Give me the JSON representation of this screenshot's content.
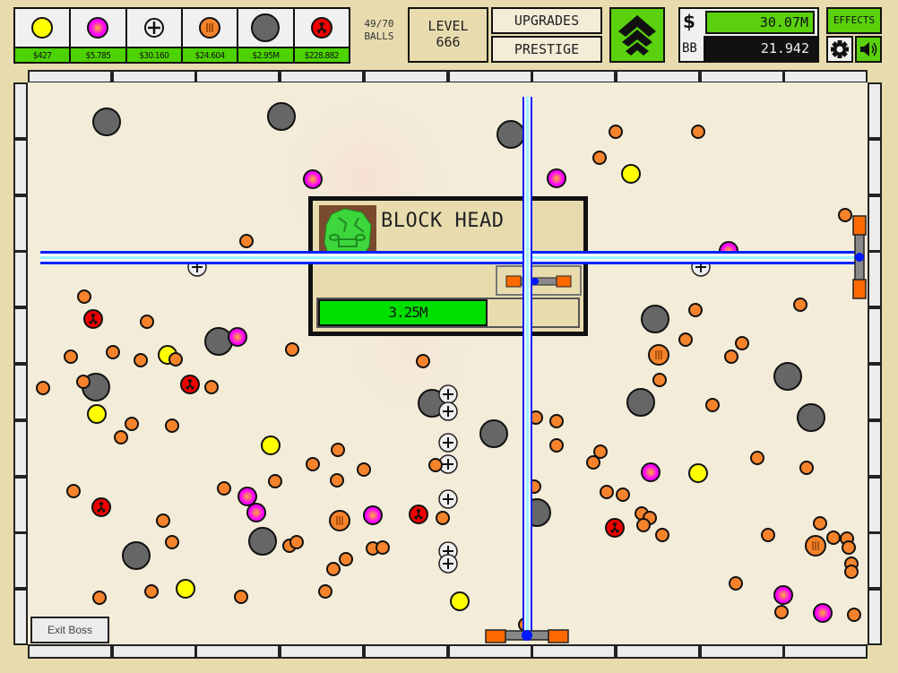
{
  "shop": [
    {
      "ball": "yellow-ball",
      "price": "$427"
    },
    {
      "ball": "plasma-ball",
      "price": "$5.785"
    },
    {
      "ball": "scatter-ball",
      "price": "$30.160"
    },
    {
      "ball": "cannon-ball",
      "price": "$24.604"
    },
    {
      "ball": "sniper-ball",
      "price": "$2.95M"
    },
    {
      "ball": "poison-ball",
      "price": "$228.882"
    }
  ],
  "balls": {
    "count": "49/70",
    "label": "BALLS"
  },
  "level": {
    "label": "LEVEL",
    "value": "666"
  },
  "buttons": {
    "upgrades": "UPGRADES",
    "prestige": "PRESTIGE",
    "effects": "EFFECTS",
    "exit_boss": "Exit Boss"
  },
  "money": {
    "cash_label": "$",
    "cash": "30.07M",
    "bb_label": "BB",
    "bb": "21.942"
  },
  "boss": {
    "name": "BLOCK HEAD",
    "hp": "3.25M",
    "hp_fraction": 0.65
  },
  "colors": {
    "field": "#f3ecd8",
    "frame": "#e8dcaf",
    "accent_green": "#5ad10c",
    "hp_green": "#00e000",
    "laser_blue": "#0022ff",
    "orange": "#f5832b",
    "yellow": "#ffff00",
    "magenta": "#ff00ff",
    "gray": "#666666",
    "red": "#ee0000"
  }
}
